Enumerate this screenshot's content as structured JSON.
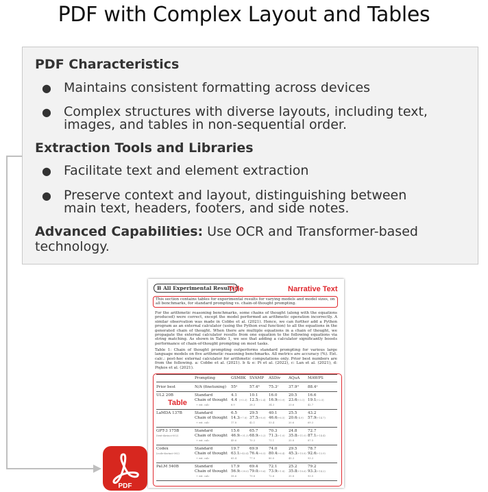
{
  "title": "PDF with Complex Layout and Tables",
  "card": {
    "pdf_heading": "PDF Characteristics",
    "pdf_bullets": [
      "Maintains consistent formatting across devices",
      "Complex structures with diverse layouts, including text,",
      "images, and tables in non-sequential order."
    ],
    "tools_heading": "Extraction Tools and Libraries",
    "tools_bullets": [
      "Facilitate text and element extraction",
      "Preserve context and layout, distinguishing between",
      "main text, headers, footers, and side notes."
    ],
    "adv_label": "Advanced Capabilities:",
    "adv_text": "Use OCR and Transformer-based",
    "adv_text2": "technology."
  },
  "doc": {
    "section": "B   All Experimental Results",
    "ann_title": "Title",
    "ann_narrative": "Narrative Text",
    "ann_table": "Table",
    "intro": "This section contains tables for experimental results for varying models and model sizes, on all benchmarks, for standard prompting vs. chain-of-thought prompting.",
    "para": "For the arithmetic reasoning benchmarks, some chains of thought (along with the equations produced) were correct, except the model performed an arithmetic operation incorrectly. A similar observation was made in Cobbe et al. (2021). Hence, we can further add a Python program as an external calculator (using the Python eval function) to all the equations in the generated chain of thought. When there are multiple equations in a chain of thought, we propagate the external calculator results from one equation to the following equations via string matching. As shown in Table 1, we see that adding a calculator significantly boosts performance of chain-of-thought prompting on most tasks.",
    "caption": "Table 1:  Chain of thought prompting outperforms standard prompting for various large language models on five arithmetic reasoning benchmarks. All metrics are accuracy (%). Ext. calc.: post-hoc external calculator for arithmetic computations only. Prior best numbers are from the following. a: Cobbe et al. (2021). b & e: Pi et al. (2022), c: Lan et al. (2021), d: Piękos et al. (2021).",
    "table": {
      "headers": [
        "Prompting",
        "GSM8K",
        "SVAMP",
        "ASDiv",
        "AQuA",
        "MAWPS"
      ],
      "prior_label": "Prior best",
      "prior_prompt": "N/A (finetuning)",
      "prior_vals": [
        "55ᵃ",
        "57.4ᵇ",
        "75.3ᶜ",
        "37.9ᵈ",
        "88.4ᵉ"
      ],
      "standard": "Standard",
      "cot": "Chain of thought",
      "extcalc": "+ ext. calc",
      "models": [
        {
          "name": "UL2 20B",
          "sub": "",
          "std": [
            "4.1",
            "10.1",
            "16.0",
            "20.5",
            "16.6"
          ],
          "cot": [
            "4.4",
            "12.5",
            "16.9",
            "23.6",
            "19.1"
          ],
          "delta": [
            "(+0.3)",
            "(+2.4)",
            "(+0.9)",
            "(+3.1)",
            "(+2.5)"
          ],
          "ext": [
            "6.9",
            "28.3",
            "34.3",
            "23.6",
            "42.7"
          ]
        },
        {
          "name": "LaMDA 137B",
          "sub": "",
          "std": [
            "6.5",
            "29.5",
            "40.1",
            "25.5",
            "43.2"
          ],
          "cot": [
            "14.3",
            "37.5",
            "46.6",
            "20.6",
            "57.9"
          ],
          "delta": [
            "(+7.8)",
            "(+8.0)",
            "(+6.5)",
            "(-4.9)",
            "(+14.7)"
          ],
          "ext": [
            "17.8",
            "42.1",
            "53.4",
            "20.6",
            "69.3"
          ]
        },
        {
          "name": "GPT-3 175B",
          "sub": "(text-davinci-002)",
          "std": [
            "15.6",
            "65.7",
            "70.3",
            "24.8",
            "72.7"
          ],
          "cot": [
            "46.9",
            "68.9",
            "71.3",
            "35.8",
            "87.1"
          ],
          "delta": [
            "(+31.3)",
            "(+3.2)",
            "(+1.0)",
            "(+11.0)",
            "(+14.4)"
          ],
          "ext": [
            "49.6",
            "70.3",
            "71.1",
            "35.8",
            "87.5"
          ]
        },
        {
          "name": "Codex",
          "sub": "(code-davinci-002)",
          "std": [
            "19.7",
            "69.9",
            "74.0",
            "29.5",
            "78.7"
          ],
          "cot": [
            "63.1",
            "76.4",
            "80.4",
            "45.3",
            "92.6"
          ],
          "delta": [
            "(+43.4)",
            "(+6.5)",
            "(+6.4)",
            "(+15.8)",
            "(+13.9)"
          ],
          "ext": [
            "65.4",
            "77.0",
            "80.0",
            "45.3",
            "93.3"
          ]
        },
        {
          "name": "PaLM 540B",
          "sub": "",
          "std": [
            "17.9",
            "69.4",
            "72.1",
            "25.2",
            "79.2"
          ],
          "cot": [
            "56.9",
            "79.0",
            "73.9",
            "35.8",
            "93.3"
          ],
          "delta": [
            "(+39.0)",
            "(+9.6)",
            "(+1.8)",
            "(+10.6)",
            "(+14.2)"
          ],
          "ext": [
            "58.6",
            "79.8",
            "72.6",
            "35.8",
            "93.5"
          ]
        }
      ]
    }
  },
  "pdf_icon_label": "PDF",
  "colors": {
    "accent_red": "#e0282e",
    "icon_red": "#d7271f",
    "card_bg": "#f2f2f2",
    "connector": "#bfbfbf"
  },
  "icons": [
    "pdf-file-icon",
    "acrobat-symbol-icon"
  ]
}
